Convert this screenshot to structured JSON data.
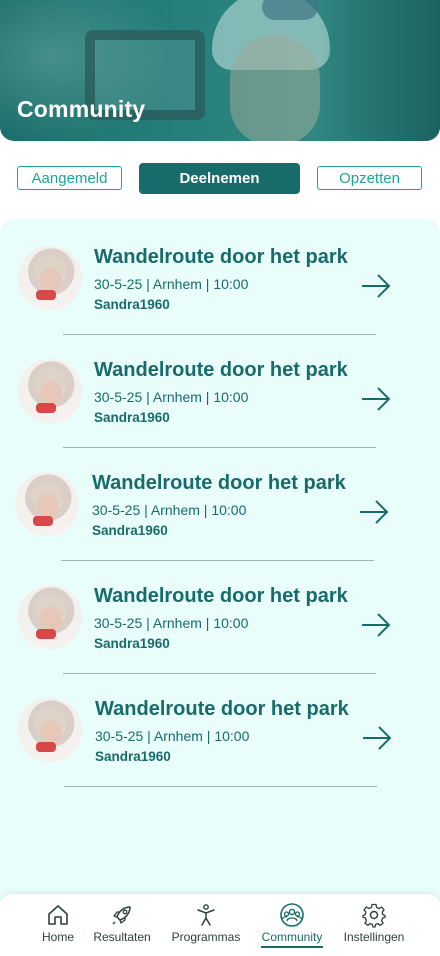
{
  "header": {
    "title": "Community"
  },
  "tabs": [
    {
      "label": "Aangemeld",
      "active": false
    },
    {
      "label": "Deelnemen",
      "active": true
    },
    {
      "label": "Opzetten",
      "active": false
    }
  ],
  "items": [
    {
      "title": "Wandelroute door het park",
      "meta": "30-5-25 | Arnhem | 10:00",
      "user": "Sandra1960"
    },
    {
      "title": "Wandelroute door het park",
      "meta": "30-5-25 | Arnhem | 10:00",
      "user": "Sandra1960"
    },
    {
      "title": "Wandelroute door het park",
      "meta": "30-5-25 | Arnhem | 10:00",
      "user": "Sandra1960"
    },
    {
      "title": "Wandelroute door het park",
      "meta": "30-5-25 | Arnhem | 10:00",
      "user": "Sandra1960"
    },
    {
      "title": "Wandelroute door het park",
      "meta": "30-5-25 | Arnhem | 10:00",
      "user": "Sandra1960"
    }
  ],
  "nav": [
    {
      "label": "Home",
      "icon": "home-icon",
      "active": false
    },
    {
      "label": "Resultaten",
      "icon": "rocket-icon",
      "active": false
    },
    {
      "label": "Programmas",
      "icon": "person-stretch-icon",
      "active": false
    },
    {
      "label": "Community",
      "icon": "group-icon",
      "active": true
    },
    {
      "label": "Instellingen",
      "icon": "gear-icon",
      "active": false
    }
  ],
  "colors": {
    "primary": "#176c6a",
    "accent": "#1fa39a",
    "panel": "#e9fdfb"
  }
}
